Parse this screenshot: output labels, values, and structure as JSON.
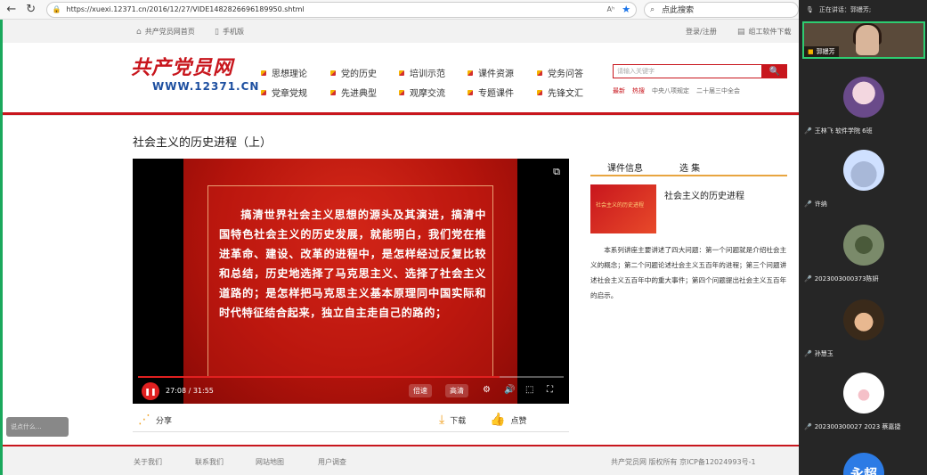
{
  "browser": {
    "url": "https://xuexi.12371.cn/2016/12/27/VIDE1482826696189950.shtml",
    "search_placeholder": "点此搜索",
    "read_label": "Aʰ"
  },
  "site_topbar": {
    "home": "共产党员网首页",
    "mobile": "手机版",
    "login": "登录/注册",
    "download": "组工软件下载"
  },
  "logo": {
    "main": "共产党员网",
    "url": "WWW.12371.CN"
  },
  "nav": {
    "row1": [
      "思想理论",
      "党的历史",
      "培训示范",
      "课件资源",
      "党务问答"
    ],
    "row2": [
      "党章党规",
      "先进典型",
      "观摩交流",
      "专题课件",
      "先锋文汇"
    ]
  },
  "search": {
    "placeholder": "请输入关键字",
    "button": "🔍"
  },
  "hot_links": {
    "latest": "最新",
    "hot": "热搜",
    "link1": "中央八项规定",
    "link2": "二十届三中全会"
  },
  "page_title": "社会主义的历史进程（上）",
  "video": {
    "subtitle_text": "搞清世界社会主义思想的源头及其演进，搞清中国特色社会主义的历史发展，就能明白，我们党在推进革命、建设、改革的进程中，是怎样经过反复比较和总结，历史地选择了马克思主义、选择了社会主义道路的；是怎样把马克思主义基本原理同中国实际和时代特征结合起来，独立自主走自己的路的；",
    "time": "27:08 / 31:55",
    "progress": 0.85,
    "speed_label": "倍速",
    "quality_label": "高清"
  },
  "actions": {
    "share": "分享",
    "download": "下载",
    "like": "点赞"
  },
  "info_panel": {
    "tab_info": "课件信息",
    "tab_episodes": "选 集",
    "thumb_title": "社会主义的历史进程",
    "course_title": "社会主义的历史进程",
    "description": "本系列讲座主要讲述了四大问题：第一个问题就是介绍社会主义的概念；第二个问题论述社会主义五百年的进程；第三个问题讲述社会主义五百年中的重大事件；第四个问题提出社会主义五百年的启示。"
  },
  "footer": {
    "about": "关于我们",
    "contact": "联系我们",
    "sitemap": "网站地图",
    "survey": "用户调查",
    "copyright": "共产党员网 版权所有 京ICP备12024993号-1"
  },
  "comment_hint": "说点什么...",
  "meeting": {
    "speaking_label": "正在讲话：",
    "speaker": "郭嫚芳;",
    "host_name": "郭嫚芳",
    "participants": [
      {
        "name": "王林飞 软件学院 6班"
      },
      {
        "name": "许纳"
      },
      {
        "name": "2023003000373陈妍"
      },
      {
        "name": "孙慧玉"
      },
      {
        "name": "202300300027 2023 蔡嘉捷"
      }
    ],
    "last_avatar_text": "永超"
  }
}
